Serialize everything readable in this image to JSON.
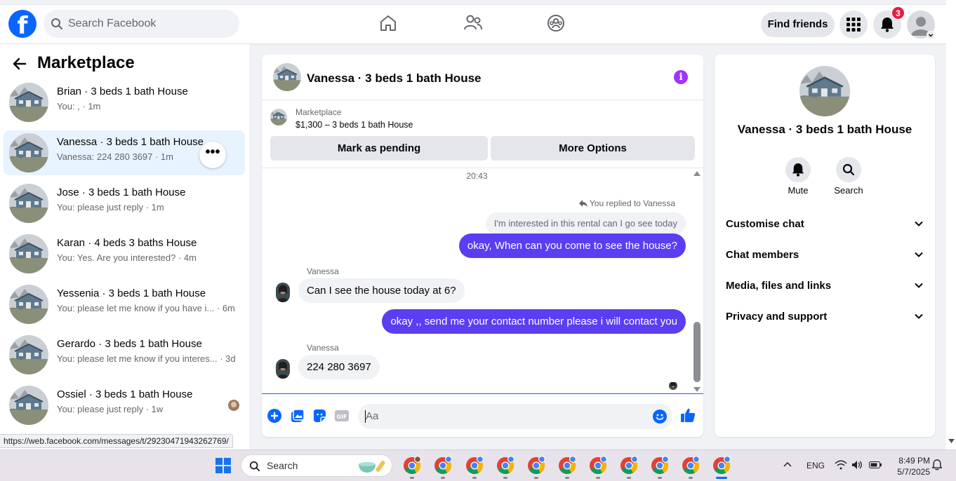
{
  "topbar": {
    "search_placeholder": "Search Facebook",
    "find_friends_label": "Find friends",
    "notification_count": "3"
  },
  "sidebar": {
    "title": "Marketplace",
    "conversations": [
      {
        "title": "Brian · 3 beds 1 bath House",
        "subtitle": "You: , · 1m",
        "active": false
      },
      {
        "title": "Vanessa · 3 beds 1 bath House",
        "subtitle": "Vanessa: 224 280 3697 · 1m",
        "active": true
      },
      {
        "title": "Jose · 3 beds 1 bath House",
        "subtitle": "You: please just reply · 1m",
        "active": false
      },
      {
        "title": "Karan · 4 beds 3 baths House",
        "subtitle": "You: Yes. Are you interested? · 4m",
        "active": false
      },
      {
        "title": "Yessenia · 3 beds 1 bath House",
        "subtitle": "You: please let me know if you have i... · 6m",
        "active": false
      },
      {
        "title": "Gerardo · 3 beds 1 bath House",
        "subtitle": "You: please let me know if you interes... · 3d",
        "active": false
      },
      {
        "title": "Ossiel · 3 beds 1 bath House",
        "subtitle": "You: please just reply · 1w",
        "active": false
      }
    ]
  },
  "status_url": "https://web.facebook.com/messages/t/29230471943262769/",
  "chat": {
    "title": "Vanessa · 3 beds 1 bath House",
    "listing_source": "Marketplace",
    "listing_title": "$1,300 – 3 beds 1 bath House",
    "mark_pending_label": "Mark as pending",
    "more_options_label": "More Options",
    "timestamp": "20:43",
    "replied_note": "You replied to Vanessa",
    "quoted_message": "I'm interested in this rental can I go see today",
    "messages": [
      {
        "from": "me",
        "text": "okay, When can you come to see the house?"
      },
      {
        "from": "Vanessa",
        "text": "Can I see the house today at 6?"
      },
      {
        "from": "me",
        "text": "okay ,, send me your contact number please i will contact you"
      },
      {
        "from": "Vanessa",
        "text": "224 280 3697"
      }
    ],
    "composer_placeholder": "Aa"
  },
  "details": {
    "title": "Vanessa · 3 beds 1 bath House",
    "mute_label": "Mute",
    "search_label": "Search",
    "sections": [
      "Customise chat",
      "Chat members",
      "Media, files and links",
      "Privacy and support"
    ]
  },
  "taskbar": {
    "search_placeholder": "Search",
    "language": "ENG",
    "time": "8:49 PM",
    "date": "5/7/2025"
  },
  "colors": {
    "brand_blue": "#0866ff",
    "outgoing_bubble": "#5b3ef2",
    "info_purple": "#a033ff",
    "badge_red": "#e41e3f"
  }
}
